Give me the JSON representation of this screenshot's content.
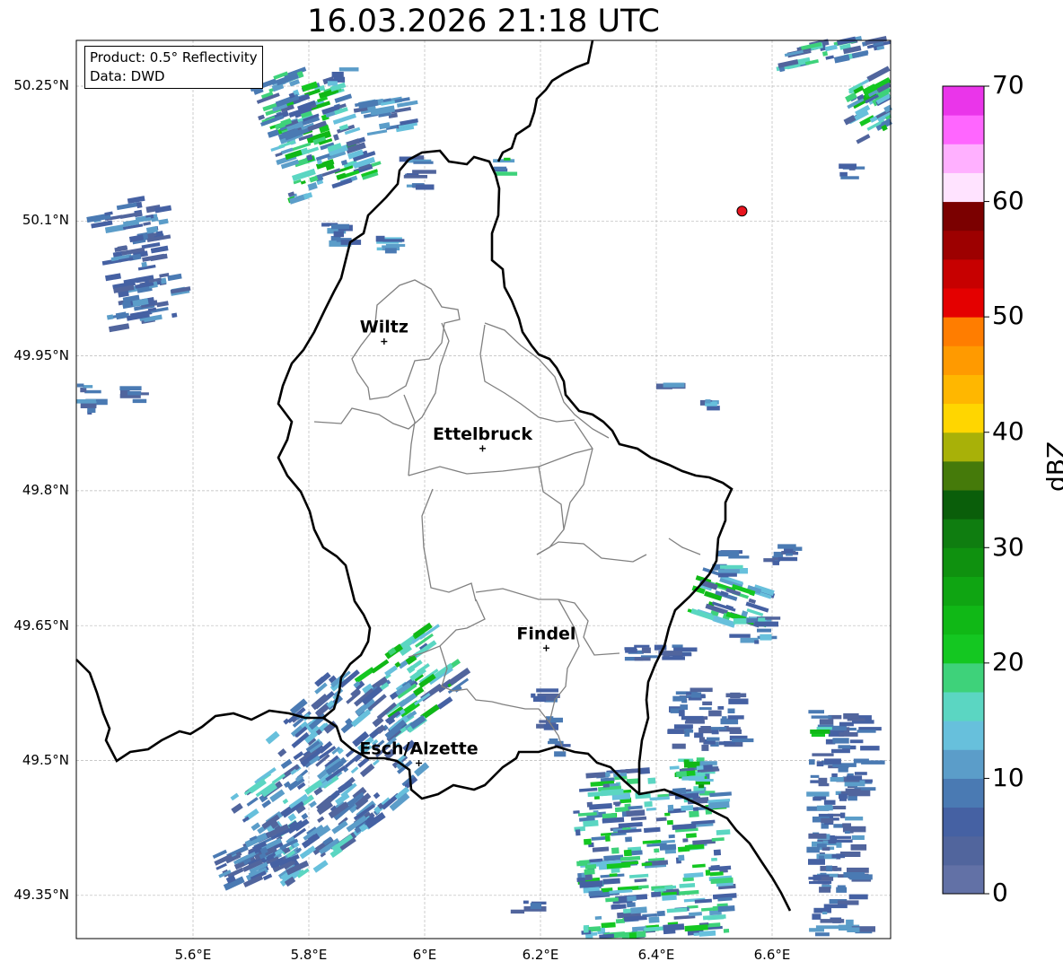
{
  "title": "16.03.2026 21:18 UTC",
  "info_box": {
    "product": "Product: 0.5° Reflectivity",
    "source": "Data: DWD"
  },
  "lat_labels": [
    "50.25°N",
    "50.1°N",
    "49.95°N",
    "49.8°N",
    "49.65°N",
    "49.5°N",
    "49.35°N"
  ],
  "lon_labels": [
    "5.6°E",
    "5.8°E",
    "6°E",
    "6.2°E",
    "6.4°E",
    "6.6°E"
  ],
  "cities": [
    {
      "name": "Wiltz",
      "lon": 5.93,
      "lat": 49.966
    },
    {
      "name": "Ettelbruck",
      "lon": 6.1,
      "lat": 49.847
    },
    {
      "name": "Findel",
      "lon": 6.21,
      "lat": 49.625
    },
    {
      "name": "Esch/Alzette",
      "lon": 5.99,
      "lat": 49.497
    }
  ],
  "radar_site": {
    "lon": 6.548,
    "lat": 50.111,
    "color": "#e8141e"
  },
  "colorbar": {
    "label": "dBZ",
    "ticks": [
      "0",
      "10",
      "20",
      "30",
      "40",
      "50",
      "60",
      "70"
    ],
    "colors": [
      "#6271a6",
      "#51659d",
      "#4561a3",
      "#4a7ab3",
      "#5b9dc9",
      "#67c0dc",
      "#5bd6c2",
      "#3ed27a",
      "#14c721",
      "#10b816",
      "#0fa512",
      "#0f910f",
      "#0f7d10",
      "#0a5e0a",
      "#457a0a",
      "#a8b108",
      "#ffd600",
      "#ffb700",
      "#ff9a00",
      "#ff7d00",
      "#e40000",
      "#c70000",
      "#9d0000",
      "#7b0000",
      "#ffe3ff",
      "#ffb0ff",
      "#ff66ff",
      "#ea35ea"
    ]
  }
}
